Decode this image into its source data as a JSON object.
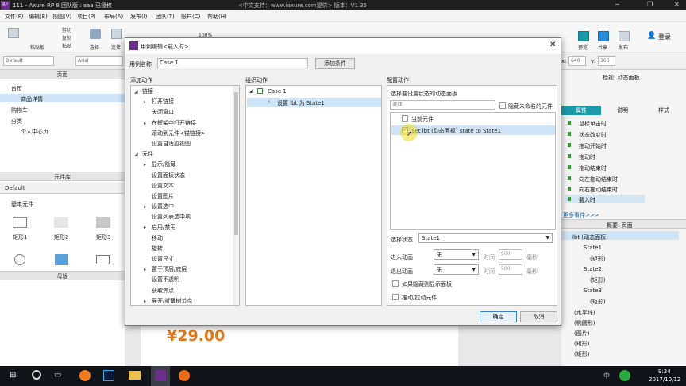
{
  "app": {
    "logo": "RP",
    "title": "111 - Axure RP 8 团队版 : aaa 已授权",
    "support": "<中文支持：www.iaxure.com提供> 版本：V1.35"
  },
  "menu": [
    "文件(F)",
    "编辑(E)",
    "视图(V)",
    "项目(P)",
    "布局(A)",
    "发布(I)",
    "团队(T)",
    "账户(C)",
    "帮助(H)"
  ],
  "toolbar": {
    "paste": "粘贴板",
    "cut": "剪切",
    "copy": "复制",
    "paste2": "粘贴",
    "select": "选择",
    "connect": "连接",
    "zoom": "100%",
    "preview": "预览",
    "share": "共享",
    "publish": "发布",
    "login": "登录"
  },
  "fmt": {
    "style": "Default",
    "font": "Arial",
    "x_label": "x:",
    "x": "640",
    "y_label": "y:",
    "y": "366"
  },
  "left": {
    "pages_header": "页面",
    "pages": [
      "首页",
      "商品详情",
      "购物车",
      "分类",
      "个人中心页"
    ],
    "lib_header": "元件库",
    "lib_default": "Default",
    "basic": "基本元件",
    "shapes": [
      "矩形1",
      "矩形2",
      "矩形3"
    ],
    "master_header": "母版"
  },
  "canvas": {
    "price": "¥29.00"
  },
  "right": {
    "inspect": "检视: 动态面板",
    "tabs": [
      "属性",
      "说明",
      "样式"
    ],
    "events": [
      "鼠标单击时",
      "状态改变时",
      "拖动开始时",
      "拖动时",
      "拖动结束时",
      "向左拖动结束时",
      "向右拖动结束时",
      "载入时"
    ],
    "more": "更多事件>>>",
    "outline_header": "概要: 页面",
    "outline": [
      "lbt (动态面板)",
      "State1",
      "(矩形)",
      "State2",
      "(矩形)",
      "State3",
      "(矩形)",
      "(水平线)",
      "(椭圆形)",
      "(图片)",
      "(矩形)",
      "(矩形)"
    ]
  },
  "modal": {
    "title": "用例编辑<载入时>",
    "case_name_label": "用例名称",
    "case_name": "Case 1",
    "add_condition": "添加条件",
    "col1_title": "添加动作",
    "col2_title": "组织动作",
    "col3_title": "配置动作",
    "actions": [
      {
        "label": "链接",
        "lvl": 0,
        "exp": "◢"
      },
      {
        "label": "打开链接",
        "lvl": 1,
        "exp": "▸"
      },
      {
        "label": "关闭窗口",
        "lvl": 1,
        "exp": ""
      },
      {
        "label": "在框架中打开链接",
        "lvl": 1,
        "exp": "▸"
      },
      {
        "label": "滚动到元件<锚链接>",
        "lvl": 1,
        "exp": ""
      },
      {
        "label": "设置自适应视图",
        "lvl": 1,
        "exp": ""
      },
      {
        "label": "元件",
        "lvl": 0,
        "exp": "◢"
      },
      {
        "label": "显示/隐藏",
        "lvl": 1,
        "exp": "▸"
      },
      {
        "label": "设置面板状态",
        "lvl": 1,
        "exp": ""
      },
      {
        "label": "设置文本",
        "lvl": 1,
        "exp": ""
      },
      {
        "label": "设置图片",
        "lvl": 1,
        "exp": ""
      },
      {
        "label": "设置选中",
        "lvl": 1,
        "exp": "▸"
      },
      {
        "label": "设置列表选中项",
        "lvl": 1,
        "exp": ""
      },
      {
        "label": "启用/禁用",
        "lvl": 1,
        "exp": "▸"
      },
      {
        "label": "移动",
        "lvl": 1,
        "exp": ""
      },
      {
        "label": "旋转",
        "lvl": 1,
        "exp": ""
      },
      {
        "label": "设置尺寸",
        "lvl": 1,
        "exp": ""
      },
      {
        "label": "置于顶层/底层",
        "lvl": 1,
        "exp": "▸"
      },
      {
        "label": "设置不透明",
        "lvl": 1,
        "exp": ""
      },
      {
        "label": "获取焦点",
        "lvl": 1,
        "exp": ""
      },
      {
        "label": "展开/折叠树节点",
        "lvl": 1,
        "exp": "▸"
      }
    ],
    "organize": {
      "case": "Case 1",
      "action": "设置 lbt 为 State1"
    },
    "config": {
      "subtitle": "选择要设置状态的动态面板",
      "search_placeholder": "查找",
      "hide_unnamed": "隐藏未命名的元件",
      "current_widget": "当前元件",
      "set_item": "Set lbt (动态面板) state to State1",
      "select_state_label": "选择状态",
      "select_state": "State1",
      "enter_anim_label": "进入动画",
      "exit_anim_label": "退出动画",
      "anim_none": "无",
      "time_label": "时间",
      "time_val": "500",
      "ms": "毫秒",
      "show_if_hidden": "如果隐藏则显示面板",
      "push_widgets": "推动/拉动元件"
    },
    "ok": "确定",
    "cancel": "取消"
  },
  "taskbar": {
    "time": "9:34",
    "date": "2017/10/12",
    "ime": "中"
  }
}
